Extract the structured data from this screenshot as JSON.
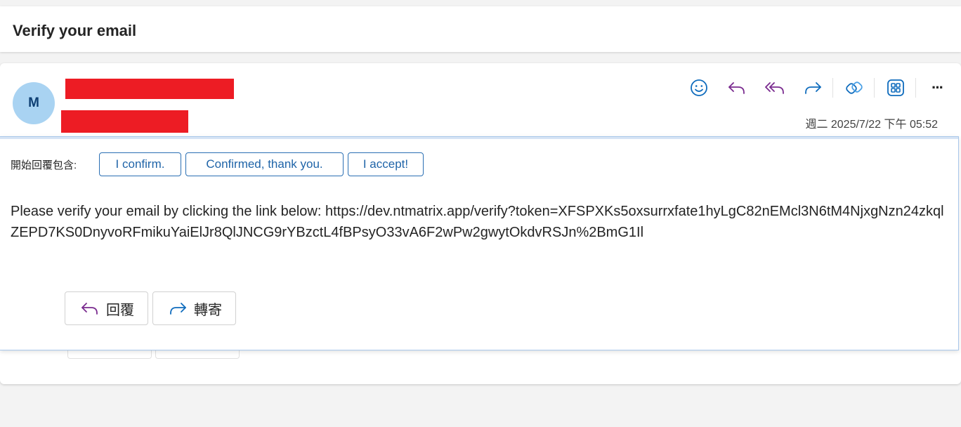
{
  "subject": "Verify your email",
  "sender": {
    "avatar_initial": "M"
  },
  "toolbar": {
    "emoji_icon": "smiley-icon",
    "reply_icon": "reply-icon",
    "reply_all_icon": "reply-all-icon",
    "forward_icon": "forward-icon",
    "copilot_icon": "copilot-icon",
    "apps_icon": "apps-icon",
    "more_label": "···"
  },
  "date": "週二 2025/7/22 下午 05:52",
  "suggested_replies": {
    "label": "開始回覆包含:",
    "chips": [
      "I confirm.",
      "Confirmed, thank you.",
      "I accept!"
    ]
  },
  "body": {
    "text": "Please verify your email by clicking the link below: https://dev.ntmatrix.app/verify?token=XFSPXKs5oxsurrxfate1hyLgC82nEMcl3N6tM4NjxgNzn24zkqlZEPD7KS0DnyvoRFmikuYaiElJr8QlJNCG9rYBzctL4fBPsyO33vA6F2wPw2gwytOkdvRSJn%2BmG1Il"
  },
  "actions": {
    "reply_label": "回覆",
    "forward_label": "轉寄"
  },
  "colors": {
    "accent": "#0f6cbd",
    "reply_purple": "#7a2b8f",
    "avatar_bg": "#a9d3f2",
    "redaction": "#ed1c24"
  }
}
